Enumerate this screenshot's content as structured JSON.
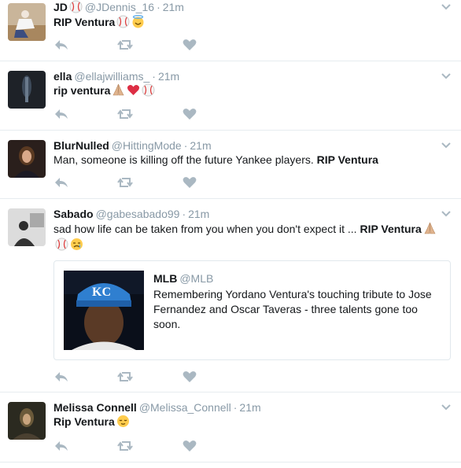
{
  "tweets": [
    {
      "name": "JD",
      "handle": "@JDennis_16",
      "sep": "·",
      "time": "21m",
      "text_bold": "RIP Ventura",
      "text_emoji": [
        "baseball-icon",
        "halo-smiley-icon"
      ]
    },
    {
      "name": "ella",
      "handle": "@ellajwilliams_",
      "sep": "·",
      "time": "21m",
      "text_bold": "rip ventura",
      "text_emoji": [
        "praying-hands-icon",
        "red-heart-icon",
        "baseball-icon"
      ]
    },
    {
      "name": "BlurNulled",
      "handle": "@HittingMode",
      "sep": "·",
      "time": "21m",
      "text_plain": "Man, someone is killing off the future Yankee players.",
      "text_bold": "RIP Ventura"
    },
    {
      "name": "Sabado",
      "handle": "@gabesabado99",
      "sep": "·",
      "time": "21m",
      "text_plain": "sad how life can be taken from you when you don't expect it ...",
      "text_bold": "RIP Ventura",
      "text_emoji": [
        "praying-hands-icon",
        "baseball-icon",
        "crying-face-icon"
      ],
      "quote": {
        "name": "MLB",
        "handle": "@MLB",
        "text": "Remembering Yordano Ventura's touching tribute to Jose Fernandez and Oscar Taveras - three talents gone too soon.",
        "image_icon": "player-photo-royals-cap"
      }
    },
    {
      "name": "Melissa Connell",
      "handle": "@Melissa_Connell",
      "sep": "·",
      "time": "21m",
      "text_bold": "Rip Ventura",
      "text_emoji": [
        "relieved-face-icon"
      ]
    }
  ],
  "icons": {
    "reply": "reply-icon",
    "retweet": "retweet-icon",
    "like": "heart-icon",
    "more": "chevron-down-icon"
  },
  "colors": {
    "icon_gray": "#aab8c2",
    "muted_text": "#8899a6",
    "divider": "#e6ecf0"
  }
}
